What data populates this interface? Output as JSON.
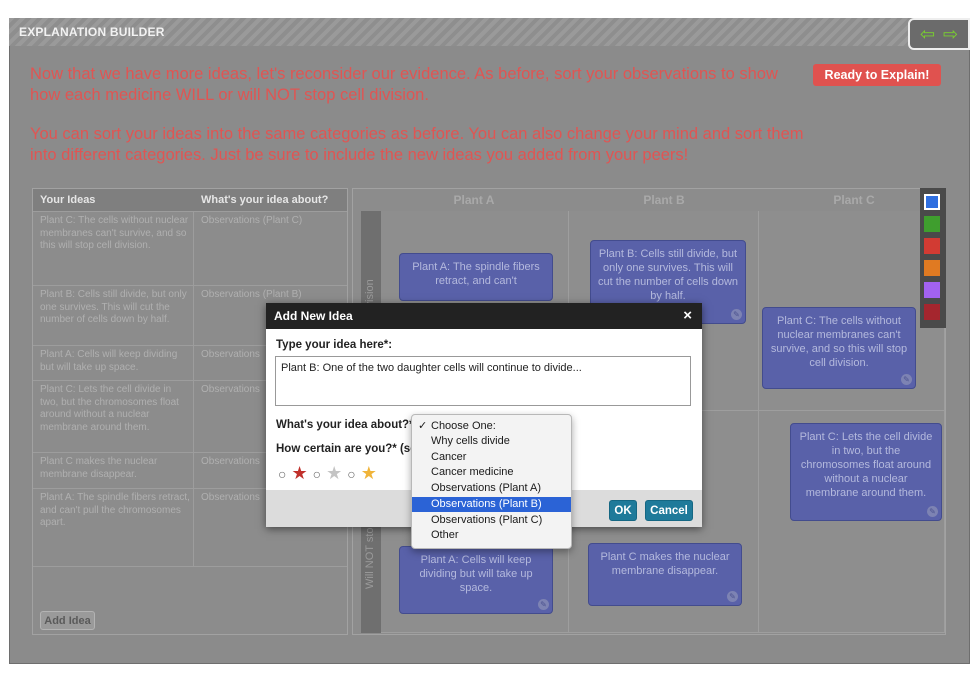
{
  "header": {
    "title": "EXPLANATION BUILDER"
  },
  "intro": {
    "p1": "Now that we have more ideas, let's reconsider our evidence. As before, sort your observations to show how each medicine WILL or will NOT stop cell division.",
    "p2": "You can sort your ideas into the same categories as before. You can also change your mind and sort them into different categories. Just be sure to include the new ideas you added from your peers!",
    "ready_label": "Ready to Explain!"
  },
  "ideas_table": {
    "col1": "Your Ideas",
    "col2": "What's your idea about?",
    "rows": [
      {
        "idea": "Plant C: The cells without nuclear membranes can't survive, and so this will stop cell division.",
        "about": "Observations (Plant C)"
      },
      {
        "idea": "Plant B: Cells still divide, but only one survives. This will cut the number of cells down by half.",
        "about": "Observations (Plant B)"
      },
      {
        "idea": "Plant A: Cells will keep dividing but will take up space.",
        "about": "Observations"
      },
      {
        "idea": "Plant C: Lets the cell divide in two, but the chromosomes float around without a nuclear membrane around them.",
        "about": "Observations"
      },
      {
        "idea": "Plant C makes the nuclear membrane disappear.",
        "about": "Observations"
      },
      {
        "idea": "Plant A: The spindle fibers retract, and can't pull the chromosomes apart.",
        "about": "Observations"
      }
    ],
    "add_label": "Add Idea"
  },
  "grid": {
    "columns": [
      "Plant A",
      "Plant B",
      "Plant C"
    ],
    "rows": [
      "division",
      "Will NOT sto"
    ],
    "cards": [
      {
        "text": "Plant A: The spindle fibers retract, and can't"
      },
      {
        "text": "Plant B: Cells still divide, but only one survives. This will cut the number of cells down by half."
      },
      {
        "text": "Plant C: The cells without nuclear membranes can't survive, and so this will stop cell division."
      },
      {
        "text": "Plant C: Lets the cell divide in two, but the chromosomes float around without a nuclear membrane around them."
      },
      {
        "text": "Plant A: Cells will keep dividing but will take up space."
      },
      {
        "text": "Plant C makes the nuclear membrane disappear."
      }
    ]
  },
  "palette": {
    "colors": [
      "#2f6fe0",
      "#3f9e2e",
      "#d23b33",
      "#e07a22",
      "#a262f0",
      "#a5262e"
    ]
  },
  "modal": {
    "title": "Add New Idea",
    "close": "×",
    "type_label": "Type your idea here*:",
    "idea_text": "Plant B: One of the two daughter cells will continue to divide...",
    "about_label": "What's your idea about?*",
    "certain_label": "How certain are you?* (se",
    "ok_label": "OK",
    "cancel_label": "Cancel"
  },
  "dropdown": {
    "options": [
      "Choose One:",
      "Why cells divide",
      "Cancer",
      "Cancer medicine",
      "Observations (Plant A)",
      "Observations (Plant B)",
      "Observations (Plant C)",
      "Other"
    ],
    "checked": "✓",
    "highlighted_index": 5
  }
}
